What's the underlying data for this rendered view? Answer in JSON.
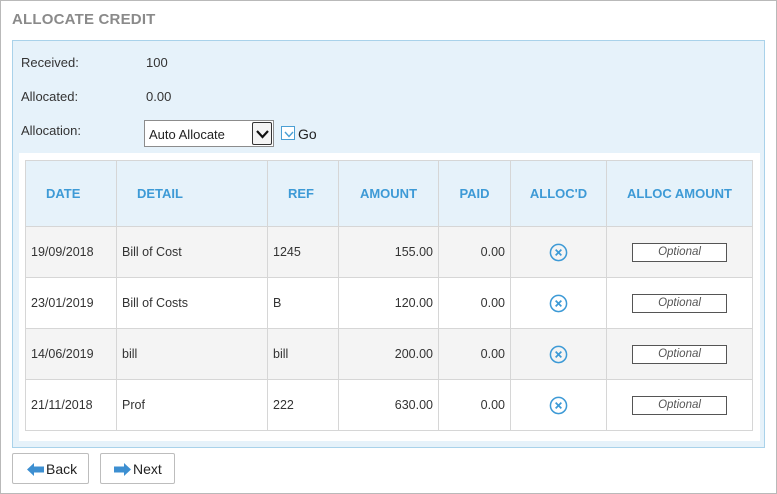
{
  "title": "ALLOCATE CREDIT",
  "summary": {
    "received_label": "Received:",
    "received_value": "100",
    "allocated_label": "Allocated:",
    "allocated_value": "0.00",
    "allocation_label": "Allocation:",
    "allocation_selected": "Auto Allocate",
    "go_label": "Go"
  },
  "table": {
    "headers": {
      "date": "DATE",
      "detail": "DETAIL",
      "ref": "REF",
      "amount": "AMOUNT",
      "paid": "PAID",
      "allocd": "ALLOC'D",
      "alloc_amount": "ALLOC AMOUNT"
    },
    "rows": [
      {
        "date": "19/09/2018",
        "detail": "Bill of Cost",
        "ref": "1245",
        "amount": "155.00",
        "paid": "0.00",
        "alloc_placeholder": "Optional"
      },
      {
        "date": "23/01/2019",
        "detail": "Bill of Costs",
        "ref": "B",
        "amount": "120.00",
        "paid": "0.00",
        "alloc_placeholder": "Optional"
      },
      {
        "date": "14/06/2019",
        "detail": "bill",
        "ref": "bill",
        "amount": "200.00",
        "paid": "0.00",
        "alloc_placeholder": "Optional"
      },
      {
        "date": "21/11/2018",
        "detail": "Prof",
        "ref": "222",
        "amount": "630.00",
        "paid": "0.00",
        "alloc_placeholder": "Optional"
      }
    ]
  },
  "buttons": {
    "back": "Back",
    "next": "Next"
  },
  "icons": {
    "allocd": "close-circle-icon",
    "back": "arrow-left-icon",
    "next": "arrow-right-icon",
    "select": "chevron-down-icon",
    "go": "checkbox-check-icon"
  },
  "colors": {
    "accent": "#3d9ad6",
    "panel_bg": "#e6f2fa",
    "panel_border": "#a9d2ea",
    "arrow_blue": "#3d8fd1"
  }
}
